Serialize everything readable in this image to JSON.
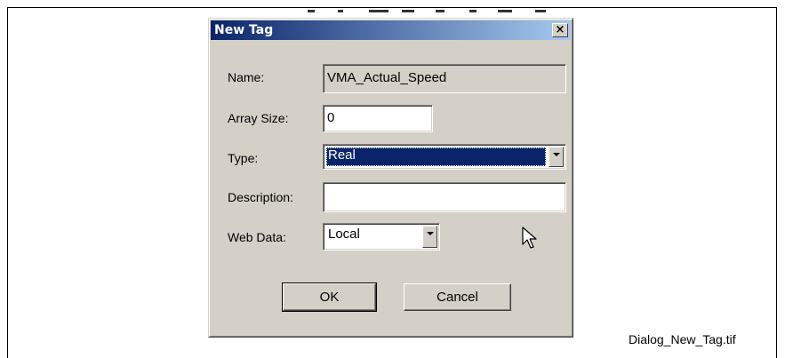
{
  "dialog": {
    "title": "New Tag",
    "close_glyph": "×"
  },
  "fields": {
    "name_label": "Name:",
    "name_value": "VMA_Actual_Speed",
    "array_size_label": "Array Size:",
    "array_size_value": "0",
    "type_label": "Type:",
    "type_value": "Real",
    "description_label": "Description:",
    "description_value": "",
    "web_data_label": "Web Data:",
    "web_data_value": "Local"
  },
  "buttons": {
    "ok_label": "OK",
    "cancel_label": "Cancel"
  },
  "caption": "Dialog_New_Tag.tif",
  "colors": {
    "titlebar_start": "#0a246a",
    "titlebar_end": "#a6caf0",
    "dialog_face": "#d4d0c8",
    "selection": "#0a246a"
  },
  "icons": {
    "close": "close-icon",
    "dropdown": "chevron-down-icon",
    "cursor": "mouse-pointer-icon"
  }
}
